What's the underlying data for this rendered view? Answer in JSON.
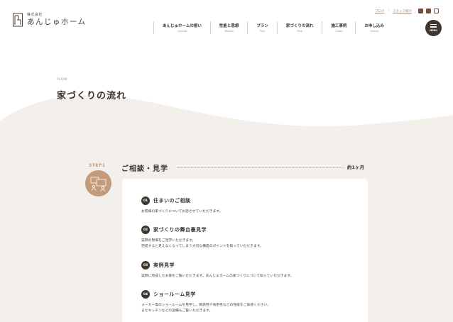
{
  "logo": {
    "sub": "株式会社",
    "main": "あんじゅホーム"
  },
  "util": {
    "blog": "ブログ",
    "staff": "スタッフ紹介",
    "sep": "|"
  },
  "nav": [
    {
      "ja": "あんじゅホームの想い",
      "en": "Concept"
    },
    {
      "ja": "性能と思想",
      "en": "Mission"
    },
    {
      "ja": "プラン",
      "en": "Plan"
    },
    {
      "ja": "家づくりの流れ",
      "en": "Flow"
    },
    {
      "ja": "施工事例",
      "en": "Cases"
    },
    {
      "ja": "お申し込み",
      "en": "Contact"
    }
  ],
  "menu_label": "MENU",
  "heading": {
    "en": "FLOW",
    "title": "家づくりの流れ"
  },
  "step": {
    "label": "STEP1",
    "title": "ご相談・見学",
    "duration": "約1ヶ月",
    "items": [
      {
        "num": "01",
        "title": "住まいのご相談",
        "desc": [
          "お客様の家づくりについてお話させていただきます。"
        ]
      },
      {
        "num": "02",
        "title": "家づくりの舞台裏見学",
        "desc": [
          "実際の現場をご見学いただきます。",
          "完成すると見えなくなってしまう大切な構造のポイントを知っていただきます。"
        ]
      },
      {
        "num": "03",
        "title": "実例見学",
        "desc": [
          "実際に完成したお家をご覧いただきます。あんじゅホームの家づくりについて知っていただきます。"
        ]
      },
      {
        "num": "04",
        "title": "ショールーム見学",
        "desc": [
          "メーカー等のショールームを見学し、断熱性や気密性などの性能をご体感ください。",
          "またキッチンなどの設備もご覧いただきます。"
        ]
      }
    ]
  },
  "colors": {
    "accent": "#c49a78",
    "dark": "#3e372f",
    "bg": "#f3f0eb"
  }
}
